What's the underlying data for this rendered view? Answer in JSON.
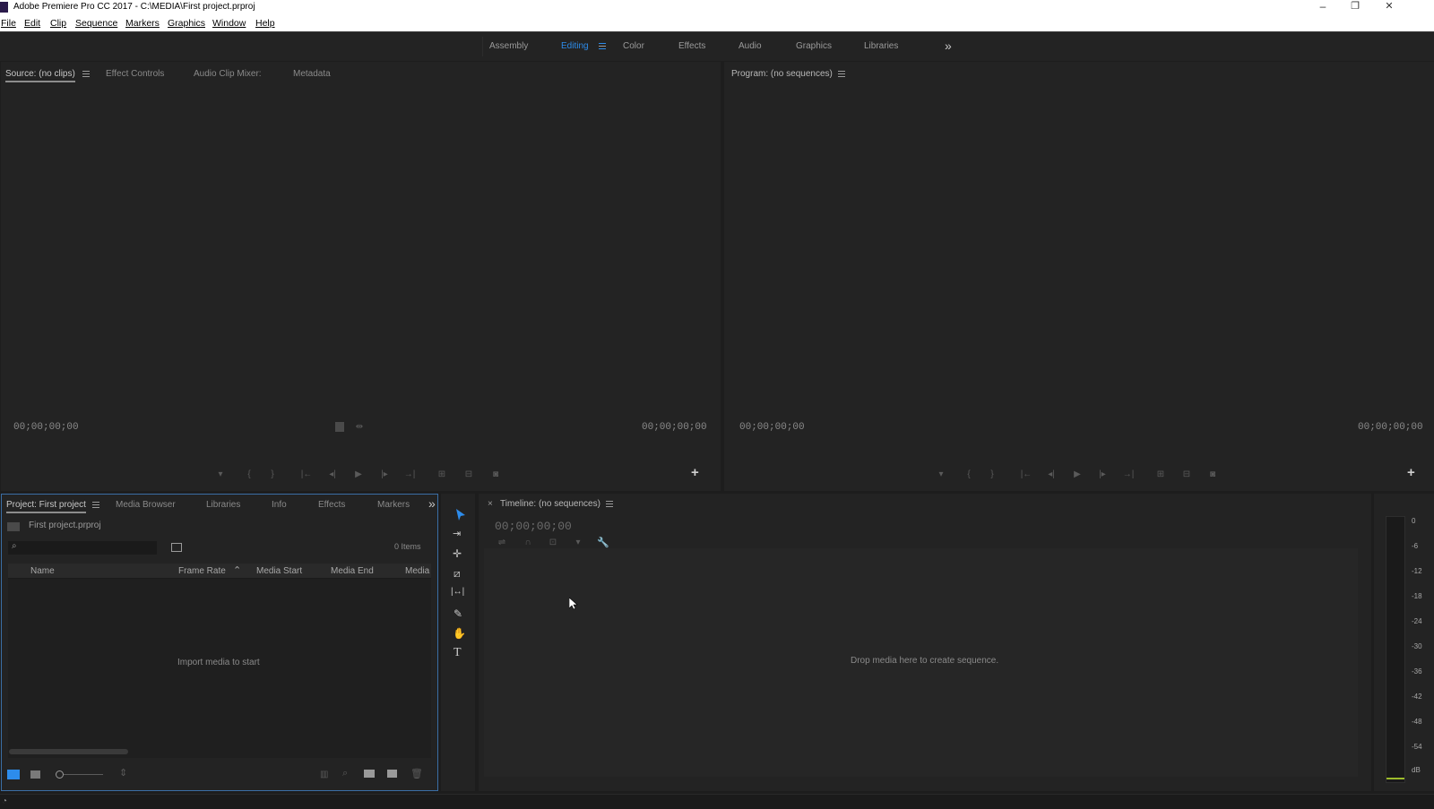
{
  "window": {
    "title": "Adobe Premiere Pro CC 2017 - C:\\MEDIA\\First project.prproj",
    "min": "–",
    "restore": "❐",
    "close": "✕"
  },
  "menu": [
    "File",
    "Edit",
    "Clip",
    "Sequence",
    "Markers",
    "Graphics",
    "Window",
    "Help"
  ],
  "workspaces": {
    "items": [
      "Assembly",
      "Editing",
      "Color",
      "Effects",
      "Audio",
      "Graphics",
      "Libraries"
    ],
    "active": "Editing",
    "overflow": "»"
  },
  "source_panel": {
    "tabs": [
      "Source: (no clips)",
      "Effect Controls",
      "Audio Clip Mixer:",
      "Metadata"
    ],
    "timecode_in": "00;00;00;00",
    "timecode_out": "00;00;00;00"
  },
  "program_panel": {
    "tab": "Program: (no sequences)",
    "timecode_in": "00;00;00;00",
    "timecode_out": "00;00;00;00"
  },
  "project_panel": {
    "tabs": [
      "Project: First project",
      "Media Browser",
      "Libraries",
      "Info",
      "Effects",
      "Markers"
    ],
    "overflow": "»",
    "project_file": "First project.prproj",
    "items_count": "0 Items",
    "columns": [
      "Name",
      "Frame Rate",
      "Media Start",
      "Media End",
      "Media"
    ],
    "empty_message": "Import media to start"
  },
  "timeline_panel": {
    "close": "×",
    "tab": "Timeline: (no sequences)",
    "timecode": "00;00;00;00",
    "empty_message": "Drop media here to create sequence."
  },
  "tools": [
    "selection-tool",
    "track-select-tool",
    "ripple-edit-tool",
    "razor-tool",
    "slip-tool",
    "pen-tool",
    "hand-tool",
    "type-tool"
  ],
  "audio_meter": {
    "scale": [
      "0",
      "-6",
      "-12",
      "-18",
      "-24",
      "-30",
      "-36",
      "-42",
      "-48",
      "-54",
      "dB"
    ]
  },
  "colors": {
    "accent": "#2d8ceb",
    "panel_bg": "#232323",
    "border": "#1a1a1a",
    "active_panel_border": "#3b6ea5"
  }
}
